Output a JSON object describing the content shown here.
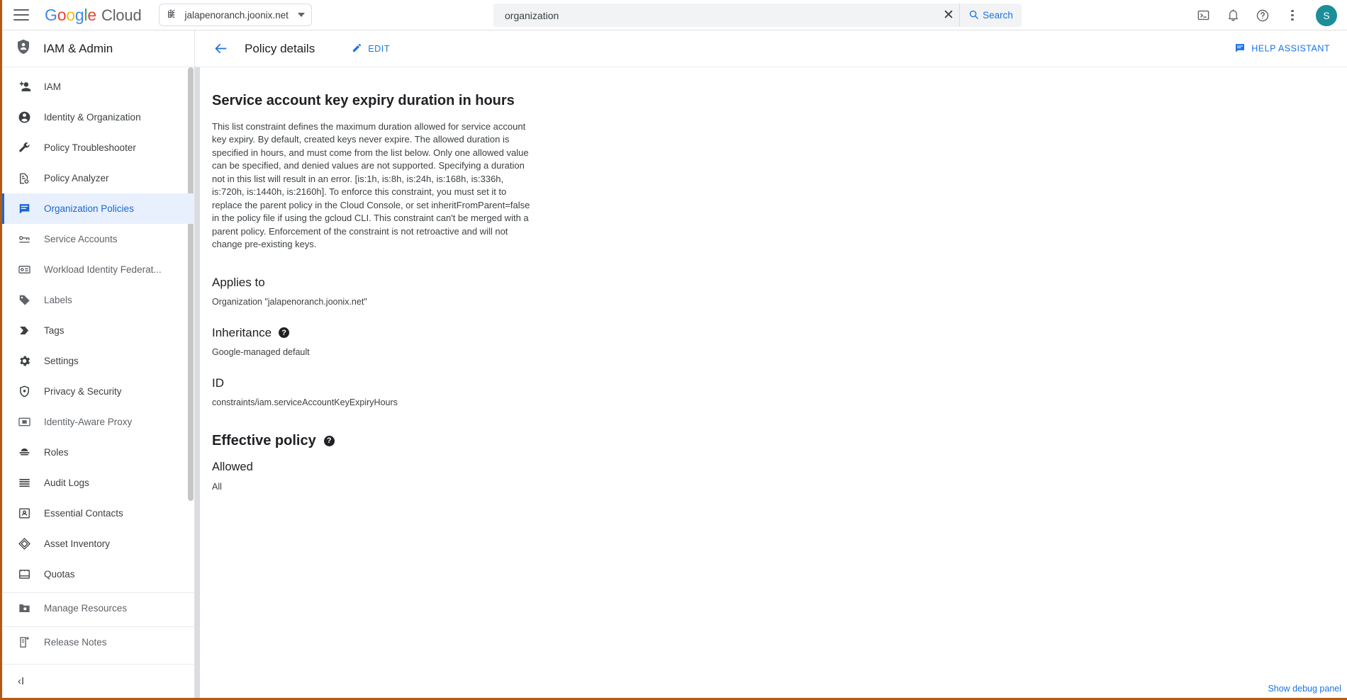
{
  "header": {
    "menu_icon": "hamburger-menu-icon",
    "brand": {
      "g1": "G",
      "g2": "o",
      "g3": "o",
      "g4": "g",
      "g5": "l",
      "g6": "e",
      "cloud": "Cloud"
    },
    "project_picker": {
      "icon": "organization-building-icon",
      "label": "jalapenoranch.joonix.net"
    },
    "search": {
      "value": "organization",
      "placeholder": "Search",
      "clear_label": "✕",
      "button_label": "Search",
      "icon": "search-icon"
    },
    "actions": [
      {
        "name": "cloud-shell-icon",
        "label": "Cloud Shell"
      },
      {
        "name": "notifications-bell-icon",
        "label": "Notifications"
      },
      {
        "name": "help-question-icon",
        "label": "Help"
      },
      {
        "name": "more-options-icon",
        "label": "More options"
      }
    ],
    "avatar": {
      "initial": "S",
      "color": "#1a8e99"
    }
  },
  "sidebar": {
    "title": "IAM & Admin",
    "title_icon": "shield-person-icon",
    "items": [
      {
        "label": "IAM",
        "icon": "person-add-icon",
        "state": "dark"
      },
      {
        "label": "Identity & Organization",
        "icon": "account-circle-icon",
        "state": "dark"
      },
      {
        "label": "Policy Troubleshooter",
        "icon": "wrench-icon",
        "state": "dark"
      },
      {
        "label": "Policy Analyzer",
        "icon": "document-search-icon",
        "state": "dark"
      },
      {
        "label": "Organization Policies",
        "icon": "policy-board-icon",
        "state": "active"
      },
      {
        "label": "Service Accounts",
        "icon": "key-card-icon",
        "state": "muted"
      },
      {
        "label": "Workload Identity Federat...",
        "icon": "id-badge-icon",
        "state": "muted"
      },
      {
        "label": "Labels",
        "icon": "label-tag-icon",
        "state": "muted"
      },
      {
        "label": "Tags",
        "icon": "tag-arrow-icon",
        "state": "dark"
      },
      {
        "label": "Settings",
        "icon": "gear-icon",
        "state": "dark"
      },
      {
        "label": "Privacy & Security",
        "icon": "shield-icon",
        "state": "dark"
      },
      {
        "label": "Identity-Aware Proxy",
        "icon": "iap-frame-icon",
        "state": "muted"
      },
      {
        "label": "Roles",
        "icon": "roles-hat-icon",
        "state": "dark"
      },
      {
        "label": "Audit Logs",
        "icon": "list-lines-icon",
        "state": "dark"
      },
      {
        "label": "Essential Contacts",
        "icon": "contact-card-icon",
        "state": "dark"
      },
      {
        "label": "Asset Inventory",
        "icon": "layers-diamond-icon",
        "state": "dark"
      },
      {
        "label": "Quotas",
        "icon": "quota-gauge-icon",
        "state": "dark"
      }
    ],
    "bottom_items": [
      {
        "label": "Manage Resources",
        "icon": "folder-settings-icon",
        "state": "muted"
      },
      {
        "label": "Release Notes",
        "icon": "notes-sparkle-icon",
        "state": "muted"
      }
    ],
    "collapse_label": "‹I",
    "collapse_name": "collapse-sidebar-button"
  },
  "toolbar": {
    "back_icon": "back-arrow-icon",
    "page_title": "Policy details",
    "edit_label": "EDIT",
    "edit_icon": "pencil-edit-icon",
    "help_assistant_label": "HELP ASSISTANT",
    "help_assistant_icon": "chat-assistant-icon"
  },
  "content": {
    "title": "Service account key expiry duration in hours",
    "description": "This list constraint defines the maximum duration allowed for service account key expiry. By default, created keys never expire. The allowed duration is specified in hours, and must come from the list below. Only one allowed value can be specified, and denied values are not supported. Specifying a duration not in this list will result in an error. [is:1h, is:8h, is:24h, is:168h, is:336h, is:720h, is:1440h, is:2160h]. To enforce this constraint, you must set it to replace the parent policy in the Cloud Console, or set inheritFromParent=false in the policy file if using the gcloud CLI. This constraint can't be merged with a parent policy. Enforcement of the constraint is not retroactive and will not change pre-existing keys.",
    "applies_to": {
      "heading": "Applies to",
      "value": "Organization \"jalapenoranch.joonix.net\""
    },
    "inheritance": {
      "heading": "Inheritance",
      "help": "?",
      "value": "Google-managed default"
    },
    "id": {
      "heading": "ID",
      "value": "constraints/iam.serviceAccountKeyExpiryHours"
    },
    "effective_policy": {
      "heading": "Effective policy",
      "help": "?",
      "sub_heading": "Allowed",
      "value": "All"
    }
  },
  "footer": {
    "debug_label": "Show debug panel"
  },
  "colors": {
    "accent": "#1a73e8",
    "active_bg": "#e8f0fe",
    "active_fg": "#1967d2",
    "avatar": "#1a8e99",
    "border_highlight": "#b45a12"
  }
}
